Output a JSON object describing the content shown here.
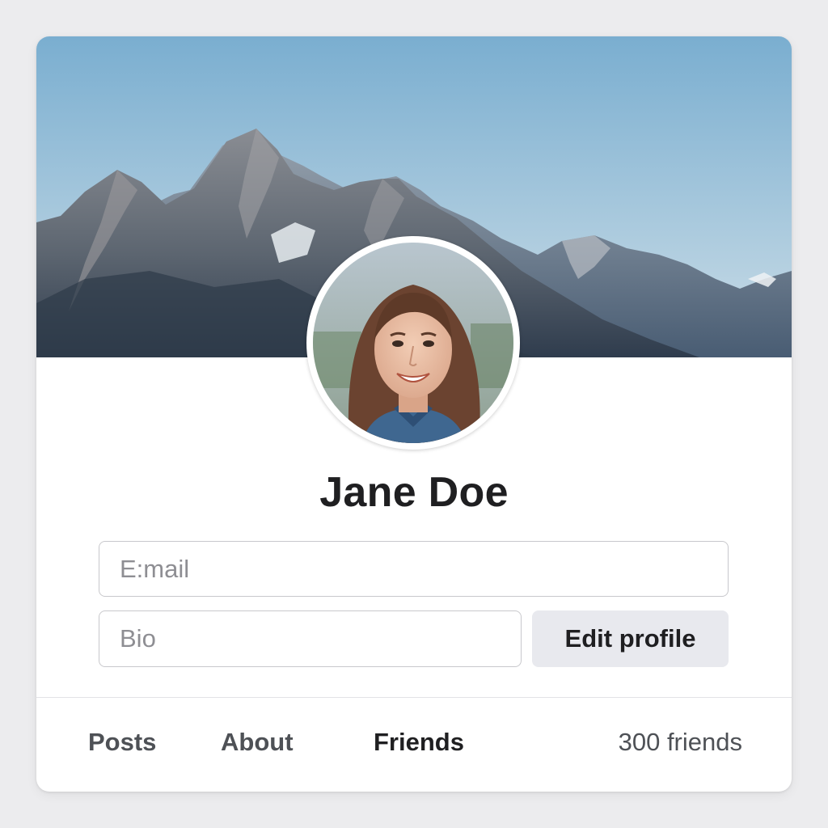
{
  "profile": {
    "name": "Jane Doe"
  },
  "form": {
    "email_placeholder": "E:mail",
    "email_value": "",
    "bio_placeholder": "Bio",
    "bio_value": "",
    "edit_button_label": "Edit profile"
  },
  "tabs": [
    {
      "label": "Posts"
    },
    {
      "label": "About"
    },
    {
      "label": "Friends",
      "selected": true
    }
  ],
  "stats": {
    "friends_count_label": "300 friends"
  },
  "images": {
    "cover": "mountain-range-cover",
    "avatar": "profile-photo"
  },
  "colors": {
    "page_background": "#ececee",
    "card_background": "#ffffff",
    "sky": "#7aaed0",
    "mountain": "#5a6676",
    "button_background": "#e8e9ee",
    "text_primary": "#1f1f21",
    "text_secondary": "#4e5156"
  }
}
